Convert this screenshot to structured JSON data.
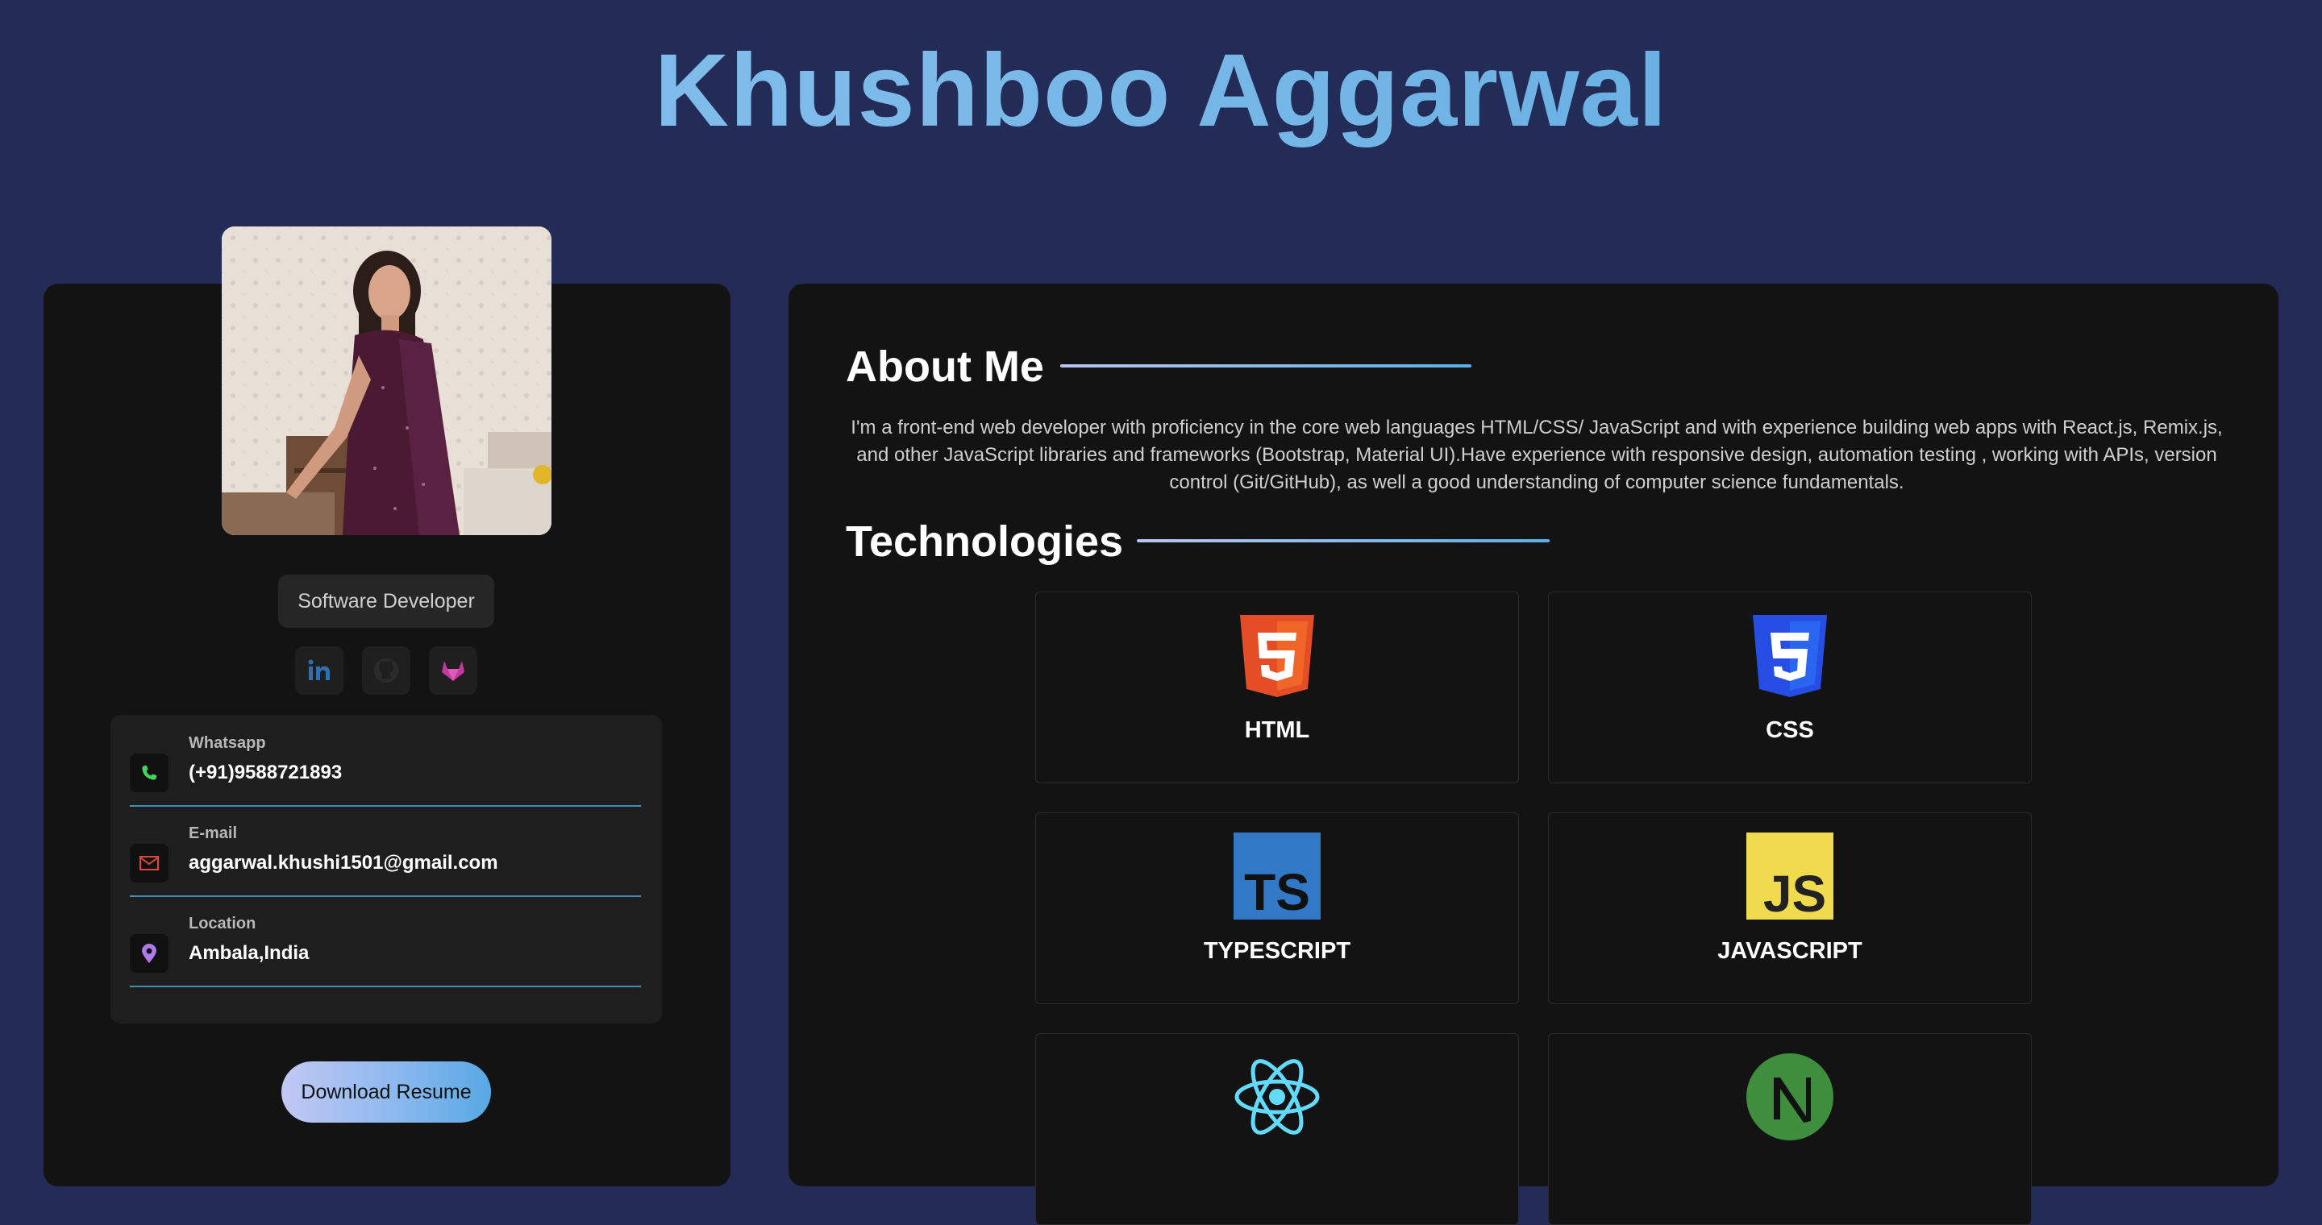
{
  "header": {
    "title": "Khushboo Aggarwal"
  },
  "profile": {
    "role": "Software Developer",
    "socials": [
      {
        "name": "LinkedIn",
        "icon": "linkedin-icon",
        "color": "#2f6fb0"
      },
      {
        "name": "GitHub",
        "icon": "github-icon",
        "color": "#2b2b2b"
      },
      {
        "name": "GitLab",
        "icon": "gitlab-icon",
        "color": "#c03aa0"
      }
    ],
    "contacts": [
      {
        "label": "Whatsapp",
        "value": "(+91)9588721893",
        "icon": "phone-icon",
        "color": "#3fd65a"
      },
      {
        "label": "E-mail",
        "value": "aggarwal.khushi1501@gmail.com",
        "icon": "mail-icon",
        "color": "#e0473a"
      },
      {
        "label": "Location",
        "value": "Ambala,India",
        "icon": "location-pin-icon",
        "color": "#b07ae8"
      }
    ],
    "download_label": "Download Resume"
  },
  "about": {
    "heading": "About Me",
    "text": "I'm a front-end web developer with proficiency in the core web languages HTML/CSS/ JavaScript and with experience building web apps with React.js, Remix.js, and other JavaScript libraries and frameworks (Bootstrap, Material UI).Have experience with responsive design, automation testing , working with APIs, version control (Git/GitHub), as well a good understanding of computer science fundamentals."
  },
  "technologies": {
    "heading": "Technologies",
    "items": [
      {
        "name": "HTML",
        "icon": "html5-icon",
        "color": "#e44d26"
      },
      {
        "name": "CSS",
        "icon": "css3-icon",
        "color": "#264de4"
      },
      {
        "name": "TYPESCRIPT",
        "icon": "typescript-icon",
        "color": "#3178c6"
      },
      {
        "name": "JAVASCRIPT",
        "icon": "javascript-icon",
        "color": "#f0db4f"
      },
      {
        "name": "",
        "icon": "react-icon",
        "color": "#61dafb"
      },
      {
        "name": "",
        "icon": "nextjs-icon",
        "color": "#3e8e3e"
      }
    ]
  },
  "colors": {
    "background": "#232b57",
    "card": "#131313",
    "accent": "#5aa9de"
  }
}
